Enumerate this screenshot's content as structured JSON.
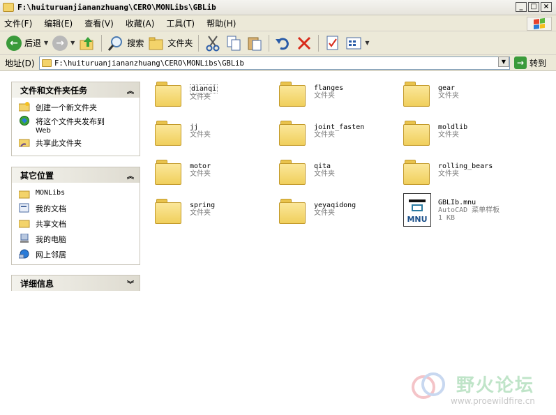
{
  "window": {
    "title": "F:\\huituruanjiananzhuang\\CERO\\MONLibs\\GBLib",
    "buttons": [
      "_",
      "□",
      "×"
    ]
  },
  "menu": {
    "items": [
      "文件(F)",
      "编辑(E)",
      "查看(V)",
      "收藏(A)",
      "工具(T)",
      "帮助(H)"
    ]
  },
  "toolbar": {
    "back": "后退",
    "search": "搜索",
    "folders": "文件夹"
  },
  "address": {
    "label": "地址(D)",
    "value": "F:\\huituruanjiananzhuang\\CERO\\MONLibs\\GBLib",
    "go": "转到"
  },
  "tasks_panel": {
    "title": "文件和文件夹任务",
    "items": [
      "创建一个新文件夹",
      "将这个文件夹发布到",
      "Web",
      "共享此文件夹"
    ]
  },
  "places_panel": {
    "title": "其它位置",
    "items": [
      "MONLibs",
      "我的文档",
      "共享文档",
      "我的电脑",
      "网上邻居"
    ]
  },
  "details_panel": {
    "title": "详细信息"
  },
  "files": [
    {
      "name": "dianqi",
      "type": "文件夹"
    },
    {
      "name": "flanges",
      "type": "文件夹"
    },
    {
      "name": "gear",
      "type": "文件夹"
    },
    {
      "name": "jj",
      "type": "文件夹"
    },
    {
      "name": "joint_fasten",
      "type": "文件夹"
    },
    {
      "name": "moldlib",
      "type": "文件夹"
    },
    {
      "name": "motor",
      "type": "文件夹"
    },
    {
      "name": "qita",
      "type": "文件夹"
    },
    {
      "name": "rolling_bears",
      "type": "文件夹"
    },
    {
      "name": "spring",
      "type": "文件夹"
    },
    {
      "name": "yeyaqidong",
      "type": "文件夹"
    },
    {
      "name": "GBLIb.mnu",
      "type": "AutoCAD 菜单样板",
      "size": "1 KB",
      "icon_label": "MNU"
    }
  ],
  "watermark": {
    "title": "野火论坛",
    "url": "www.proewildfire.cn"
  }
}
